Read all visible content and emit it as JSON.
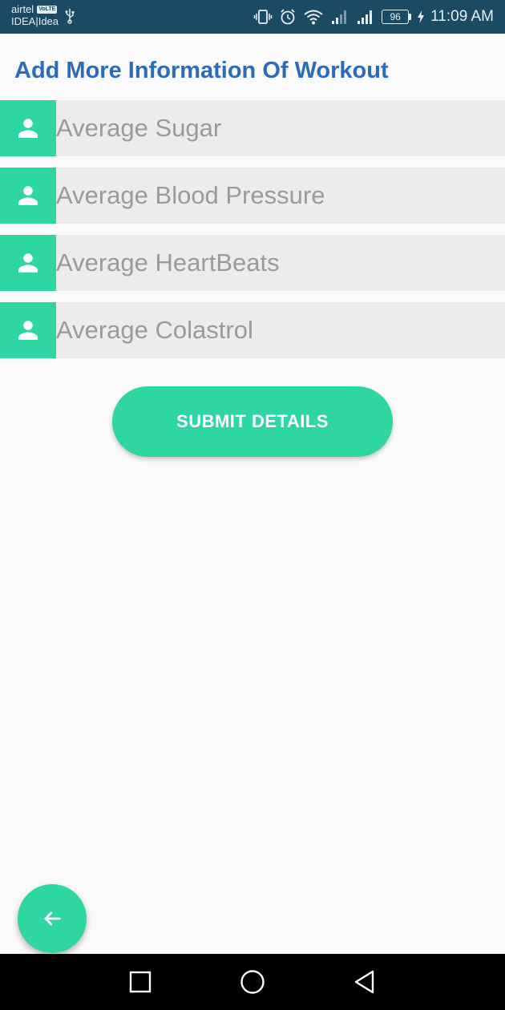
{
  "status_bar": {
    "carrier_1": "airtel",
    "volte_badge": "VoLTE",
    "carrier_2": "IDEA|Idea",
    "battery_level": "96",
    "time": "11:09 AM"
  },
  "page": {
    "title": "Add More Information Of Workout"
  },
  "fields": [
    {
      "placeholder": "Average Sugar",
      "icon": "person-icon"
    },
    {
      "placeholder": "Average Blood Pressure",
      "icon": "person-icon"
    },
    {
      "placeholder": "Average HeartBeats",
      "icon": "person-icon"
    },
    {
      "placeholder": "Average Colastrol",
      "icon": "person-icon"
    }
  ],
  "submit_label": "SUBMIT DETAILS",
  "fab_icon": "arrow-back-icon",
  "nav_bar": {
    "recents_icon": "square-icon",
    "home_icon": "circle-icon",
    "back_icon": "triangle-back-icon"
  },
  "colors": {
    "accent": "#2ed6a2",
    "title": "#2b6cb8",
    "status_bar": "#1d4a63",
    "field_bg": "#ececec"
  }
}
